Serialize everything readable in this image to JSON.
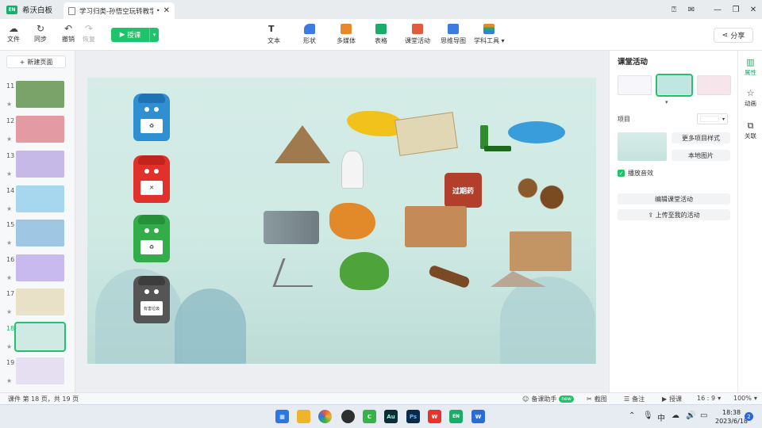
{
  "titlebar": {
    "app_name": "希沃白板",
    "app_logo": "EN",
    "tab_title": "学习归类-孙悟空玩转教学-4...",
    "tab_dot": "•",
    "tab_close": "✕",
    "icons": [
      "feedback-icon",
      "mail-icon",
      "minimize-icon",
      "restore-icon",
      "close-icon"
    ]
  },
  "toolbar": {
    "file": "文件",
    "sync": "同步",
    "undo": "撤销",
    "redo": "恢复",
    "start_class": "授课",
    "tools": [
      "文本",
      "形状",
      "多媒体",
      "表格",
      "课堂活动",
      "思维导图",
      "学科工具"
    ],
    "share": "分享"
  },
  "left_panel": {
    "new_page": "新建页面",
    "slides": [
      {
        "num": "11",
        "color": "#7aa36a"
      },
      {
        "num": "12",
        "color": "#e49aa3"
      },
      {
        "num": "13",
        "color": "#c6b9e8"
      },
      {
        "num": "14",
        "color": "#a7d7ef"
      },
      {
        "num": "15",
        "color": "#9fc7e4"
      },
      {
        "num": "16",
        "color": "#c8b9ef"
      },
      {
        "num": "17",
        "color": "#e9e0c8"
      },
      {
        "num": "18",
        "color": "#cfe9e3",
        "active": true
      },
      {
        "num": "19",
        "color": "#e6dff2"
      }
    ]
  },
  "canvas": {
    "bin_labels": [
      "♻",
      "✕",
      "♻",
      "有害垃圾"
    ],
    "jar_label": "过期药"
  },
  "right_panel": {
    "title": "课堂活动",
    "item_label": "项目",
    "more_styles": "更多项目样式",
    "local_image": "本地图片",
    "sound_effect": "播放音效",
    "edit_activity": "编辑课堂活动",
    "upload": "上传至我的活动",
    "down": "▾"
  },
  "rail": {
    "items": [
      "属性",
      "动画",
      "关联"
    ]
  },
  "status": {
    "page_info": "课件 第 18 页，共 19 页",
    "assistant": "备课助手",
    "new_badge": "new",
    "screenshot": "截图",
    "notes": "备注",
    "teach": "授课",
    "ratio": "16 : 9",
    "zoom": "100%"
  },
  "taskbar": {
    "time": "18:38",
    "date": "2023/6/18",
    "notifications": "2",
    "apps": [
      {
        "name": "windows-start",
        "color": "#2b78e4",
        "label": "▦"
      },
      {
        "name": "file-explorer",
        "color": "#f0b429",
        "label": ""
      },
      {
        "name": "browser",
        "color": "#e8583d",
        "label": ""
      },
      {
        "name": "media-app",
        "color": "#2e2e2e",
        "label": ""
      },
      {
        "name": "camtasia",
        "color": "#35b34a",
        "label": "C"
      },
      {
        "name": "audition",
        "color": "#0a2f35",
        "label": "Au"
      },
      {
        "name": "photoshop",
        "color": "#0b2b4a",
        "label": "Ps"
      },
      {
        "name": "wps",
        "color": "#e7332a",
        "label": "W"
      },
      {
        "name": "seewo",
        "color": "#1aad68",
        "label": "EN"
      },
      {
        "name": "word",
        "color": "#2b6cd4",
        "label": "W"
      }
    ]
  }
}
